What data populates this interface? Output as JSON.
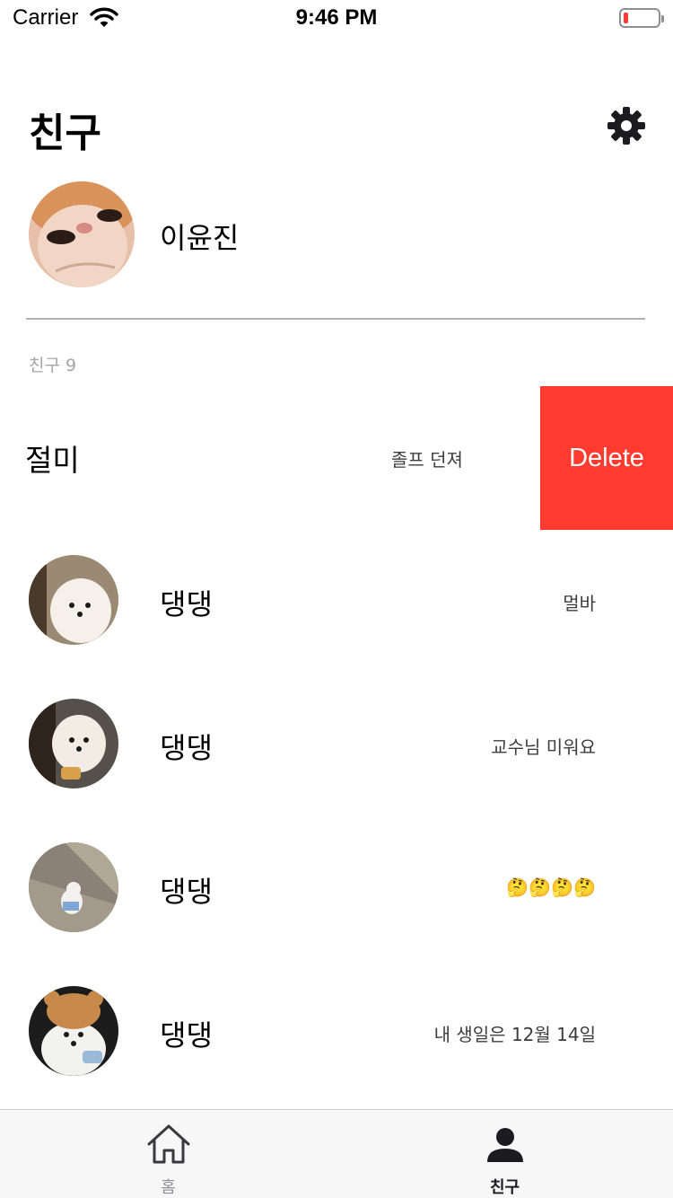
{
  "status_bar": {
    "carrier": "Carrier",
    "time": "9:46 PM",
    "battery_color": "#ff3b30",
    "wifi_icon": "wifi-icon",
    "battery_icon": "battery-low-icon"
  },
  "header": {
    "title": "친구",
    "settings_icon": "gear-icon"
  },
  "my_profile": {
    "name": "이윤진",
    "avatar": "cat-photo-avatar"
  },
  "friends_section": {
    "label": "친구 9"
  },
  "swiped_friend": {
    "name": "절미",
    "status": "졸프 던져",
    "delete_label": "Delete",
    "delete_color": "#ff3b30"
  },
  "friends": [
    {
      "name": "댕댕",
      "status": "멀바",
      "avatar": "puppy-photo-avatar"
    },
    {
      "name": "댕댕",
      "status": "교수님 미워요",
      "avatar": "puppy-photo-avatar"
    },
    {
      "name": "댕댕",
      "status": "🤔🤔🤔🤔",
      "avatar": "puppy-photo-avatar"
    },
    {
      "name": "댕댕",
      "status": "내 생일은 12월 14일",
      "avatar": "puppy-photo-avatar"
    }
  ],
  "tab_bar": {
    "tabs": [
      {
        "label": "홈",
        "icon": "house-icon",
        "selected": false
      },
      {
        "label": "친구",
        "icon": "person-icon",
        "selected": true
      }
    ]
  }
}
